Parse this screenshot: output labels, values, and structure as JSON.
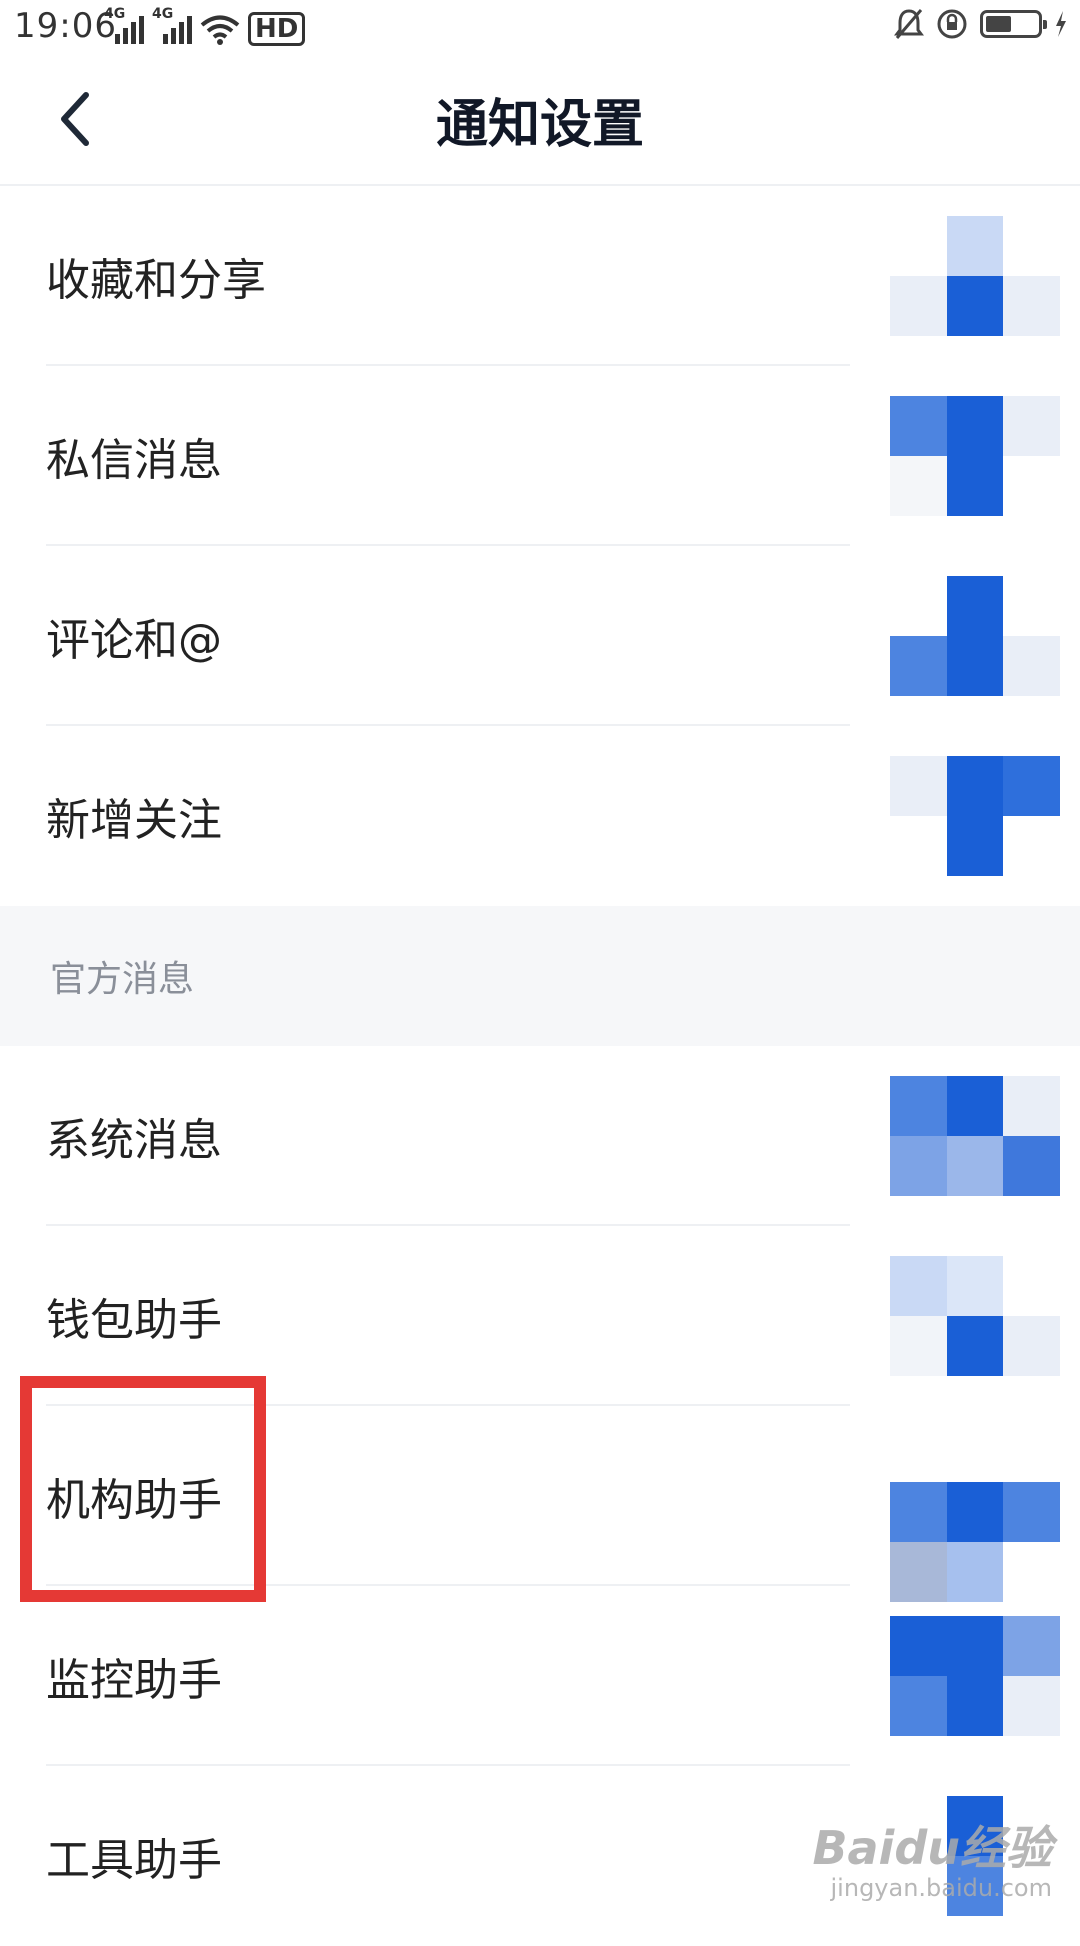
{
  "status_bar": {
    "time": "19:06",
    "net_1": "4G",
    "net_2": "4G",
    "hd": "HD"
  },
  "header": {
    "title": "通知设置"
  },
  "list": {
    "items": [
      {
        "label": "收藏和分享"
      },
      {
        "label": "私信消息"
      },
      {
        "label": "评论和@"
      },
      {
        "label": "新增关注"
      }
    ],
    "section_official": "官方消息",
    "official_items": [
      {
        "label": "系统消息"
      },
      {
        "label": "钱包助手"
      },
      {
        "label": "机构助手"
      },
      {
        "label": "监控助手"
      },
      {
        "label": "工具助手"
      }
    ]
  },
  "annotation": {
    "highlight_color": "#e53935"
  },
  "accent_color": "#1a5fd6",
  "watermark": {
    "main": "Baidu经验",
    "sub": "jingyan.baidu.com"
  }
}
